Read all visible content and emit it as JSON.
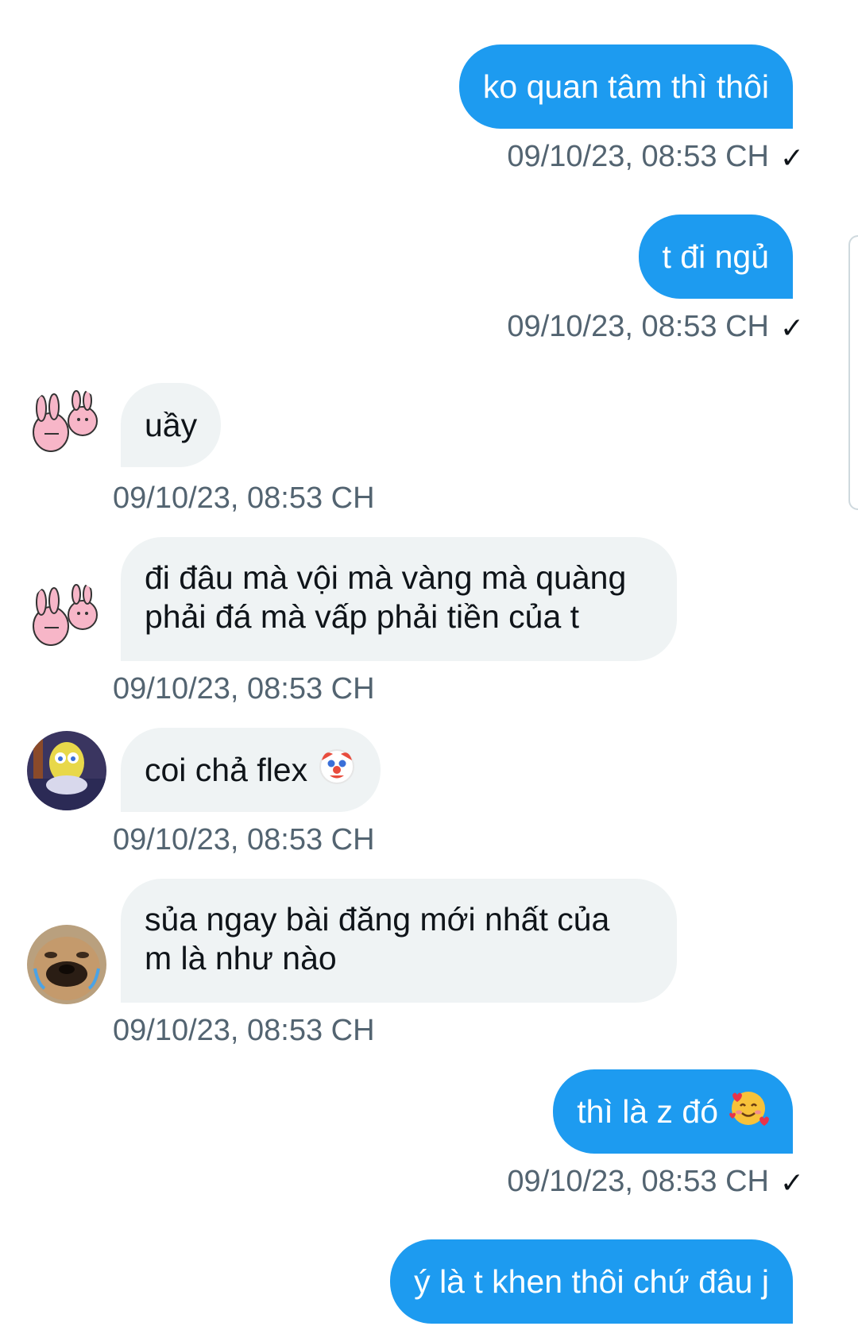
{
  "colors": {
    "outgoing_bubble": "#1d9bf0",
    "incoming_bubble": "#eff3f4",
    "timestamp": "#536471"
  },
  "messages": [
    {
      "direction": "outgoing",
      "text": "ko quan tâm thì thôi",
      "time": "09/10/23, 08:53 CH",
      "status_icon": "check-icon"
    },
    {
      "direction": "outgoing",
      "text": "t đi ngủ",
      "time": "09/10/23, 08:53 CH",
      "status_icon": "check-icon"
    },
    {
      "direction": "incoming",
      "avatar": "bunny-sticker-avatar",
      "text": "uầy",
      "time": "09/10/23, 08:53 CH"
    },
    {
      "direction": "incoming",
      "avatar": "bunny-sticker-avatar",
      "text_line1": "đi đâu mà vội mà vàng mà quàng",
      "text_line2": "phải đá mà vấp phải tiền của t",
      "time": "09/10/23, 08:53 CH"
    },
    {
      "direction": "incoming",
      "avatar": "sponge-cartoon-avatar",
      "text": "coi chả flex",
      "emoji": "clown-face-emoji",
      "time": "09/10/23, 08:53 CH"
    },
    {
      "direction": "incoming",
      "avatar": "dog-meme-avatar",
      "text_line1": "sủa ngay bài đăng mới nhất của",
      "text_line2": "m là như nào",
      "time": "09/10/23, 08:53 CH"
    },
    {
      "direction": "outgoing",
      "text": "thì là z đó",
      "emoji": "smiling-face-with-hearts-emoji",
      "time": "09/10/23, 08:53 CH",
      "status_icon": "check-icon"
    },
    {
      "direction": "outgoing",
      "text": "ý là t khen thôi chứ đâu j"
    }
  ]
}
